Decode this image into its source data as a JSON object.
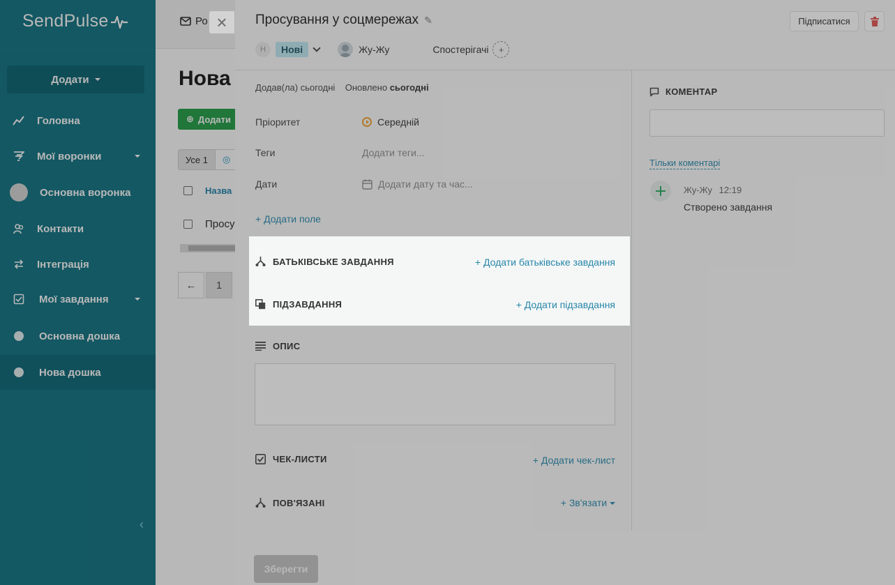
{
  "sidebar": {
    "logo": "SendPulse",
    "add_button": "Додати",
    "items": [
      {
        "label": "Головна",
        "icon": "chart-line-icon"
      },
      {
        "label": "Мої воронки",
        "icon": "funnel-icon"
      },
      {
        "label": "Основна воронка",
        "icon": "circle-icon"
      },
      {
        "label": "Контакти",
        "icon": "contacts-icon"
      },
      {
        "label": "Інтеграція",
        "icon": "integration-arrows-icon"
      },
      {
        "label": "Мої завдання",
        "icon": "checkbox-icon"
      },
      {
        "label": "Основна дошка",
        "icon": "circle-icon"
      },
      {
        "label": "Нова дошка",
        "icon": "circle-icon"
      }
    ]
  },
  "background": {
    "topbar_text": "Ро",
    "page_title": "Нова",
    "green_button": "Додати",
    "tab_all": "Усе 1",
    "table_header": "Назва",
    "table_row": "Просу",
    "pager_prev": "←",
    "pager_page": "1"
  },
  "task": {
    "title": "Просування у соцмережах",
    "subscribe": "Підписатися",
    "status_initial": "Н",
    "status": "Нові",
    "assignee": "Жу-Жу",
    "watchers": "Спостерігачі",
    "meta_added": "Додав(ла) сьогодні",
    "meta_updated_prefix": "Оновлено",
    "meta_updated_value": "сьогодні",
    "fields": {
      "priority_label": "Пріоритет",
      "priority_value": "Середній",
      "tags_label": "Теги",
      "tags_placeholder": "Додати теги...",
      "dates_label": "Дати",
      "dates_placeholder": "Додати дату та час..."
    },
    "add_field": "+ Додати поле",
    "sections": {
      "parent_title": "БАТЬКІВСЬКЕ ЗАВДАННЯ",
      "parent_link": "+ Додати батьківське завдання",
      "subtasks_title": "ПІДЗАВДАННЯ",
      "subtasks_link": "+ Додати підзавдання",
      "description_title": "ОПИС",
      "checklists_title": "ЧЕК-ЛИСТИ",
      "checklists_link": "+ Додати чек-лист",
      "related_title": "ПОВ'ЯЗАНІ",
      "related_link": "+ Зв'язати"
    },
    "save": "Зберегти"
  },
  "comments": {
    "title": "КОМЕНТАР",
    "filter": "Тільки коментарі",
    "activity_user": "Жу-Жу",
    "activity_time": "12:19",
    "activity_text": "Створено завдання"
  }
}
